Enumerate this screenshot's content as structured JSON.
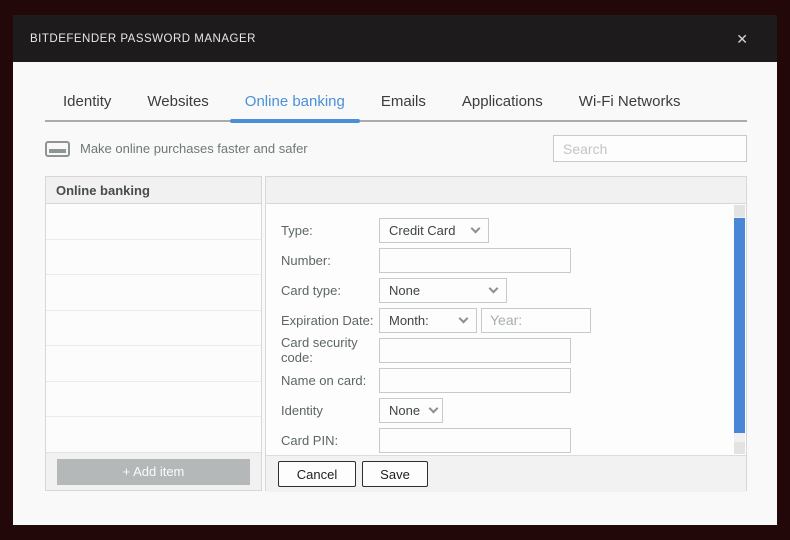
{
  "window": {
    "title": "BITDEFENDER PASSWORD MANAGER",
    "close_icon": "✕"
  },
  "tabs": [
    {
      "label": "Identity",
      "active": false
    },
    {
      "label": "Websites",
      "active": false
    },
    {
      "label": "Online banking",
      "active": true
    },
    {
      "label": "Emails",
      "active": false
    },
    {
      "label": "Applications",
      "active": false
    },
    {
      "label": "Wi-Fi Networks",
      "active": false
    }
  ],
  "banner": {
    "icon": "credit-card-icon",
    "text": "Make online purchases faster and safer"
  },
  "search": {
    "placeholder": "Search"
  },
  "list_panel": {
    "header": "Online banking",
    "items": [
      "",
      "",
      "",
      "",
      "",
      "",
      ""
    ],
    "add_button_label": "+ Add item"
  },
  "form": {
    "type": {
      "label": "Type:",
      "value": "Credit Card"
    },
    "number": {
      "label": "Number:",
      "value": ""
    },
    "card_type": {
      "label": "Card type:",
      "value": "None"
    },
    "expiration": {
      "label": "Expiration Date:",
      "month_value": "Month:",
      "year_placeholder": "Year:",
      "year_value": ""
    },
    "security_code": {
      "label": "Card security code:",
      "value": ""
    },
    "name_on_card": {
      "label": "Name on card:",
      "value": ""
    },
    "identity": {
      "label": "Identity",
      "value": "None"
    },
    "card_pin": {
      "label": "Card PIN:",
      "value": ""
    }
  },
  "actions": {
    "cancel_label": "Cancel",
    "save_label": "Save"
  },
  "colors": {
    "accent": "#4a90d9",
    "scrollbar_thumb": "#4a86d8",
    "titlebar_bg": "#1d1b1b",
    "frame_bg": "#220808"
  }
}
